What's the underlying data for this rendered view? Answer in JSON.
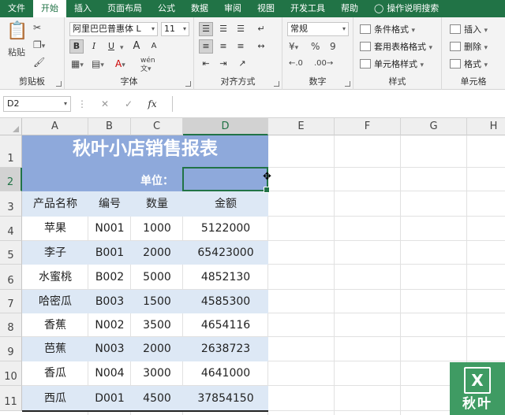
{
  "ribbon_tabs": [
    "文件",
    "开始",
    "插入",
    "页面布局",
    "公式",
    "数据",
    "审阅",
    "视图",
    "开发工具",
    "帮助",
    "操作说明搜索"
  ],
  "active_tab": "开始",
  "clipboard": {
    "paste_label": "粘贴",
    "group_label": "剪贴板"
  },
  "font": {
    "name": "阿里巴巴普惠体 L",
    "size": "11",
    "bold": "B",
    "italic": "I",
    "underline": "U",
    "grow": "A",
    "shrink": "A",
    "wen": "wén",
    "group_label": "字体"
  },
  "align": {
    "group_label": "对齐方式"
  },
  "number": {
    "format": "常规",
    "percent": "%",
    "comma": "9",
    "group_label": "数字"
  },
  "styles": {
    "cond_format": "条件格式",
    "table_format": "套用表格格式",
    "cell_styles": "单元格样式",
    "group_label": "样式"
  },
  "cells_grp": {
    "insert": "插入",
    "delete": "删除",
    "format": "格式",
    "group_label": "单元格"
  },
  "formula_bar": {
    "name_box": "D2",
    "cancel": "✕",
    "enter": "✓",
    "fx": "fx",
    "value": ""
  },
  "columns": [
    "A",
    "B",
    "C",
    "D",
    "E",
    "F",
    "G",
    "H"
  ],
  "rows": [
    "1",
    "2",
    "3",
    "4",
    "5",
    "6",
    "7",
    "8",
    "9",
    "10",
    "11"
  ],
  "sheet": {
    "title": "秋叶小店销售报表",
    "unit_label": "单位：",
    "headers": [
      "产品名称",
      "编号",
      "数量",
      "金额"
    ],
    "records": [
      [
        "苹果",
        "N001",
        "1000",
        "5122000"
      ],
      [
        "李子",
        "B001",
        "2000",
        "65423000"
      ],
      [
        "水蜜桃",
        "B002",
        "5000",
        "4852130"
      ],
      [
        "哈密瓜",
        "B003",
        "1500",
        "4585300"
      ],
      [
        "香蕉",
        "N002",
        "3500",
        "4654116"
      ],
      [
        "芭蕉",
        "N003",
        "2000",
        "2638723"
      ],
      [
        "香瓜",
        "N004",
        "3000",
        "4641000"
      ],
      [
        "西瓜",
        "D001",
        "4500",
        "37854150"
      ]
    ]
  },
  "colors": {
    "ribbon_green": "#217346",
    "title_fill": "#8ea9db",
    "stripe_fill": "#dde8f5"
  },
  "logo": {
    "mark": "X",
    "name": "秋叶"
  }
}
